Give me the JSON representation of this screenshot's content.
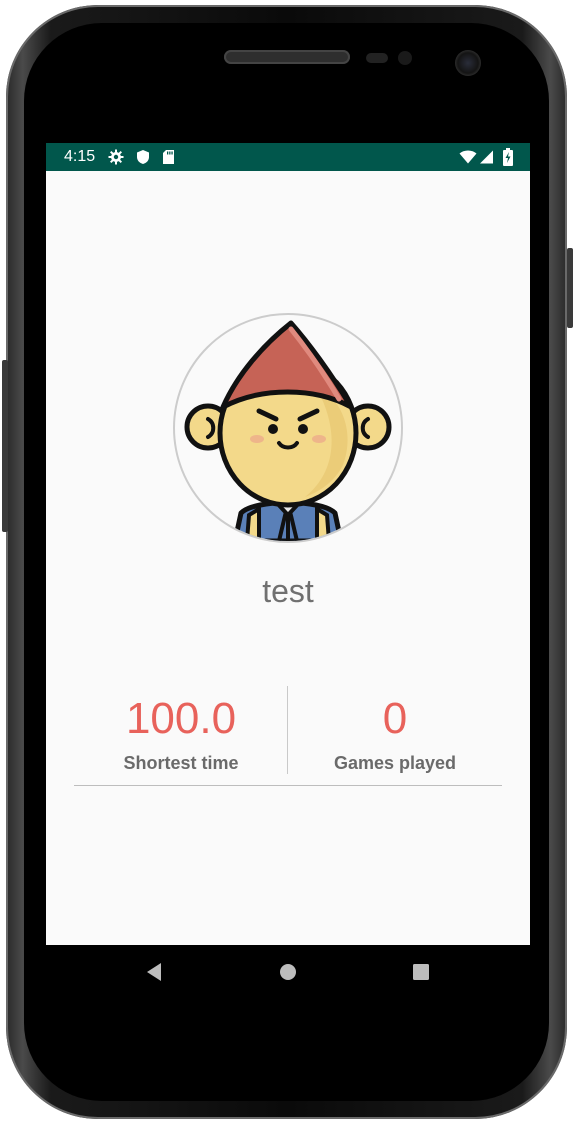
{
  "status_bar": {
    "time": "4:15",
    "color": "#01574c",
    "left_icons": [
      "gear-icon",
      "shield-icon",
      "sd-card-icon"
    ],
    "right_icons": [
      "wifi-icon",
      "signal-icon",
      "battery-charging-icon"
    ]
  },
  "profile": {
    "username": "test",
    "avatar_icon": "gnome-avatar-icon"
  },
  "stats": [
    {
      "value": "100.0",
      "label": "Shortest time"
    },
    {
      "value": "0",
      "label": "Games played"
    }
  ],
  "accent_color": "#e8625b",
  "nav_bar": {
    "buttons": [
      "back-icon",
      "home-icon",
      "recents-icon"
    ]
  }
}
